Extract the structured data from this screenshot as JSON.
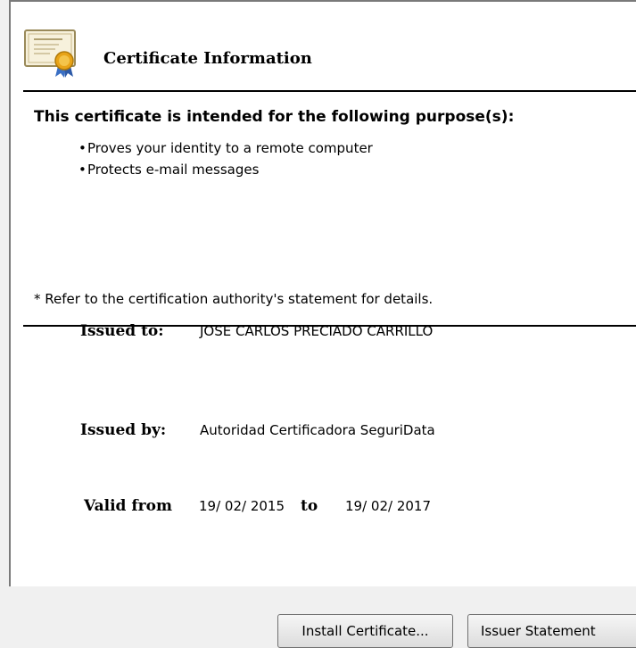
{
  "header": {
    "title": "Certificate Information"
  },
  "purposes": {
    "heading": "This certificate is intended for the following purpose(s):",
    "bullet": "•",
    "items": [
      "Proves your identity to a remote computer",
      "Protects e-mail messages"
    ]
  },
  "footnote": "* Refer to the certification authority's statement for details.",
  "details": {
    "issued_to_label": "Issued to:",
    "issued_to_value": "JOSE CARLOS PRECIADO CARRILLO",
    "issued_by_label": "Issued by:",
    "issued_by_value": "Autoridad Certificadora SeguriData",
    "valid_from_label": "Valid from",
    "valid_from_value": "19/ 02/ 2015",
    "valid_to_label": "to",
    "valid_to_value": "19/ 02/ 2017"
  },
  "buttons": {
    "install": "Install Certificate...",
    "issuer_statement": "Issuer Statement"
  },
  "colors": {
    "panel_bg": "#ffffff",
    "window_bg": "#f0f0f0",
    "rule": "#000000",
    "ribbon": "#3a6fc4",
    "seal": "#e8a317"
  },
  "icons": {
    "header": "certificate-icon"
  }
}
